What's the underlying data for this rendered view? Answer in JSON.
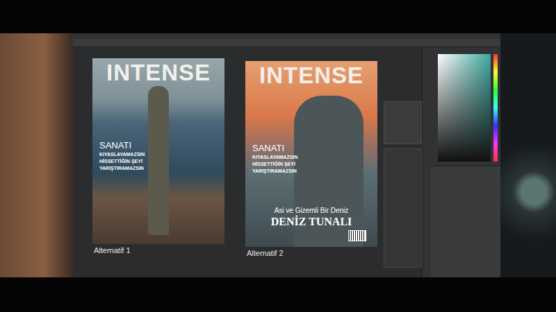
{
  "artboards": [
    {
      "label": "Alternatif 1",
      "scene": "dusk",
      "cover": {
        "masthead": "INTENSE",
        "headline": "SANATI",
        "lines": [
          "KIYASLAYAMAZSIN",
          "HİSSETTİĞİN ŞEYİ",
          "YARIŞTIRAMAZSIN"
        ]
      }
    },
    {
      "label": "Alternatif 2",
      "scene": "sunset",
      "cover": {
        "masthead": "INTENSE",
        "headline": "SANATI",
        "lines": [
          "KIYASLAYAMAZSIN",
          "HİSSETTİĞİN ŞEYİ",
          "YARIŞTIRAMAZSIN"
        ],
        "subtitle": "Asi ve Gizemli Bir Deniz",
        "name": "DENİZ TUNALI",
        "barcode": true
      }
    }
  ]
}
